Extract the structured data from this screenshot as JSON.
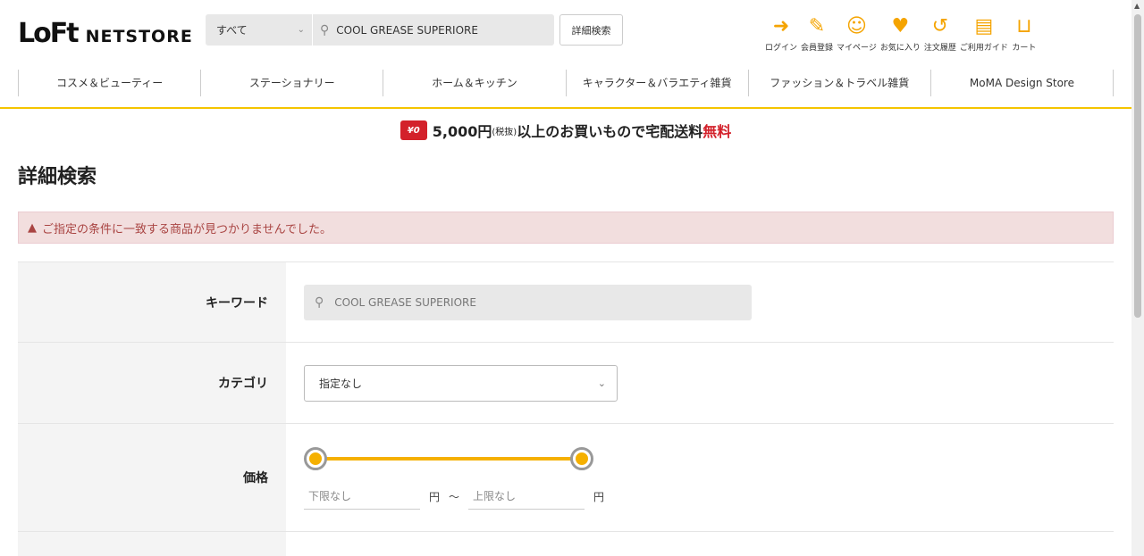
{
  "header": {
    "logo_main": "LoFt",
    "logo_sub": "NETSTORE",
    "search_scope": "すべて",
    "search_value": "COOL GREASE SUPERIORE",
    "advanced_search_label": "詳細検索",
    "icons": [
      {
        "name": "login-icon",
        "glyph": "➜",
        "label": "ログイン"
      },
      {
        "name": "register-icon",
        "glyph": "✎",
        "label": "会員登録"
      },
      {
        "name": "mypage-icon",
        "glyph": "☺",
        "label": "マイページ"
      },
      {
        "name": "favorite-icon",
        "glyph": "♥",
        "label": "お気に入り"
      },
      {
        "name": "order-history-icon",
        "glyph": "↺",
        "label": "注文履歴"
      },
      {
        "name": "guide-icon",
        "glyph": "▤",
        "label": "ご利用ガイド"
      },
      {
        "name": "cart-icon",
        "glyph": "⊔",
        "label": "カート"
      }
    ]
  },
  "category_nav": [
    "コスメ＆ビューティー",
    "ステーショナリー",
    "ホーム＆キッチン",
    "キャラクター＆バラエティ雑貨",
    "ファッション＆トラベル雑貨",
    "MoMA Design Store"
  ],
  "promo": {
    "truck_label": "¥0",
    "amount": "5,000円",
    "tax_note": "(税抜)",
    "text": "以上のお買いもので宅配送料",
    "free": "無料"
  },
  "page_title": "詳細検索",
  "alert": {
    "icon": "▲",
    "message": "ご指定の条件に一致する商品が見つかりませんでした。"
  },
  "form": {
    "keyword_label": "キーワード",
    "keyword_value": "COOL GREASE SUPERIORE",
    "category_label": "カテゴリ",
    "category_value": "指定なし",
    "price_label": "価格",
    "price_min_placeholder": "下限なし",
    "price_max_placeholder": "上限なし",
    "yen": "円",
    "tilde": "〜"
  },
  "colors": {
    "accent": "#f5b000",
    "alert_bg": "#f2dede",
    "alert_text": "#a94442",
    "promo_red": "#d3212b"
  }
}
